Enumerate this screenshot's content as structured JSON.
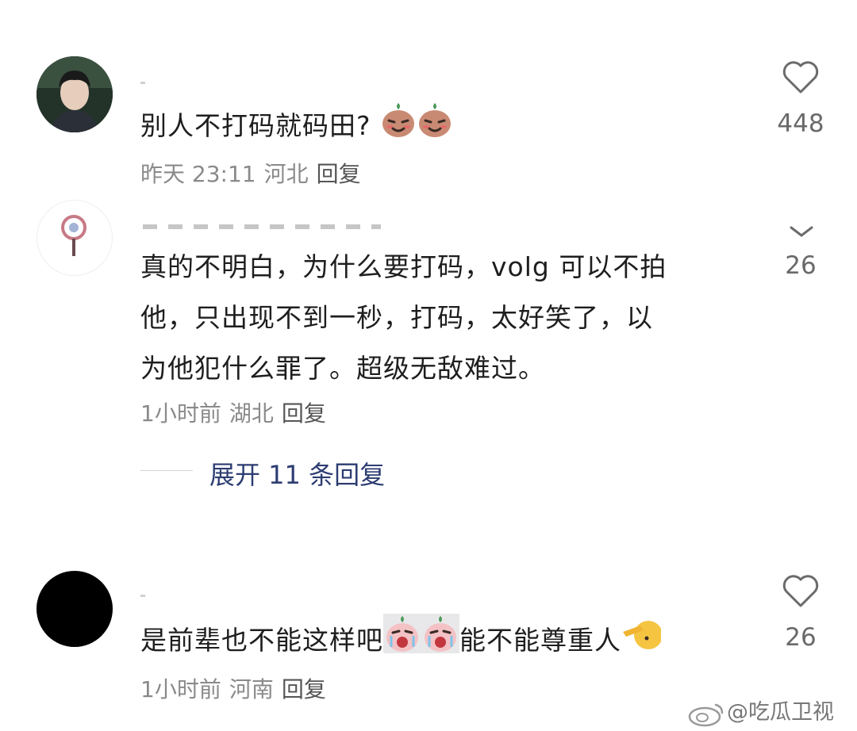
{
  "comments": [
    {
      "text": "别人不打码就码田?",
      "emoji": [
        "smirk-bean-icon",
        "smirk-bean-icon"
      ],
      "time": "昨天 23:11",
      "location": "河北",
      "reply": "回复",
      "likes": "448"
    },
    {
      "lines": [
        "真的不明白，为什么要打码，volg 可以不拍",
        "他，只出现不到一秒，打码，太好笑了，以",
        "为他犯什么罪了。超级无敌难过。"
      ],
      "time": "1小时前",
      "location": "湖北",
      "reply": "回复",
      "likes": "26",
      "expand_label": "展开 11 条回复"
    },
    {
      "text_a": "是前辈也不能这样吧",
      "text_b": "能不能尊重人",
      "emoji": [
        "crying-bean-icon",
        "crying-bean-icon",
        "salute-face-icon"
      ],
      "time": "1小时前",
      "location": "河南",
      "reply": "回复",
      "likes": "26"
    }
  ],
  "watermark": "@吃瓜卫视",
  "colors": {
    "link": "#2d3d72",
    "meta": "#8a8a8a",
    "text": "#1e1e1e"
  }
}
